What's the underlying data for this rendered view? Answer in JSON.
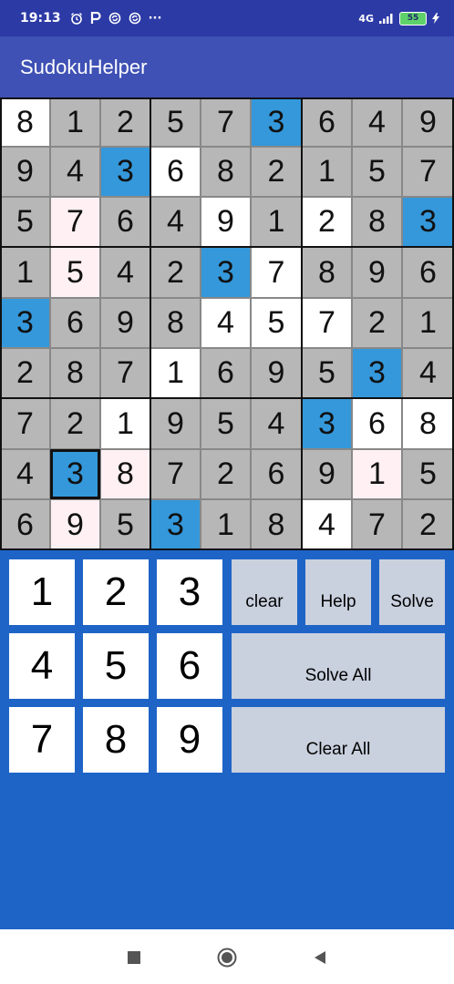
{
  "status_bar": {
    "time": "19:13",
    "left_icons": [
      "alarm-icon",
      "parking-icon",
      "sync-icon",
      "sync-icon",
      "more-dots-icon"
    ],
    "network": "4G",
    "battery": "55",
    "dots": "···"
  },
  "app_bar": {
    "title": "SudokuHelper"
  },
  "board": {
    "digits": [
      [
        8,
        1,
        2,
        5,
        7,
        3,
        6,
        4,
        9
      ],
      [
        9,
        4,
        3,
        6,
        8,
        2,
        1,
        5,
        7
      ],
      [
        5,
        7,
        6,
        4,
        9,
        1,
        2,
        8,
        3
      ],
      [
        1,
        5,
        4,
        2,
        3,
        7,
        8,
        9,
        6
      ],
      [
        3,
        6,
        9,
        8,
        4,
        5,
        7,
        2,
        1
      ],
      [
        2,
        8,
        7,
        1,
        6,
        9,
        5,
        3,
        4
      ],
      [
        7,
        2,
        1,
        9,
        5,
        4,
        3,
        6,
        8
      ],
      [
        4,
        3,
        8,
        7,
        2,
        6,
        9,
        1,
        5
      ],
      [
        6,
        9,
        5,
        3,
        1,
        8,
        4,
        7,
        2
      ]
    ],
    "states": [
      [
        "user",
        "given",
        "given",
        "given",
        "given",
        "hl",
        "given",
        "given",
        "given"
      ],
      [
        "given",
        "given",
        "hl",
        "user",
        "given",
        "given",
        "given",
        "given",
        "given"
      ],
      [
        "given",
        "conflict",
        "given",
        "given",
        "user",
        "given",
        "user",
        "given",
        "hl"
      ],
      [
        "given",
        "conflict",
        "given",
        "given",
        "hl",
        "user",
        "given",
        "given",
        "given"
      ],
      [
        "hl",
        "given",
        "given",
        "given",
        "user",
        "user",
        "user",
        "given",
        "given"
      ],
      [
        "given",
        "given",
        "given",
        "user",
        "given",
        "given",
        "given",
        "hl",
        "given"
      ],
      [
        "given",
        "given",
        "user",
        "given",
        "given",
        "given",
        "hl",
        "user",
        "user"
      ],
      [
        "given",
        "sel",
        "conflict",
        "given",
        "given",
        "given",
        "given",
        "conflict",
        "given"
      ],
      [
        "given",
        "conflict",
        "given",
        "hl",
        "given",
        "given",
        "user",
        "given",
        "given"
      ]
    ],
    "selected_cell": {
      "row": 8,
      "col": 2
    },
    "colors": {
      "given": "#b7b7b7",
      "user": "#ffffff",
      "conflict": "#fff0f3",
      "highlight": "#3498db"
    }
  },
  "keypad": {
    "numbers": [
      "1",
      "2",
      "3",
      "4",
      "5",
      "6",
      "7",
      "8",
      "9"
    ],
    "clear": "clear",
    "help": "Help",
    "solve": "Solve",
    "solve_all": "Solve All",
    "clear_all": "Clear All"
  },
  "nav_bar": {
    "recents_icon": "square-icon",
    "home_icon": "circle-icon",
    "back_icon": "triangle-back-icon"
  }
}
